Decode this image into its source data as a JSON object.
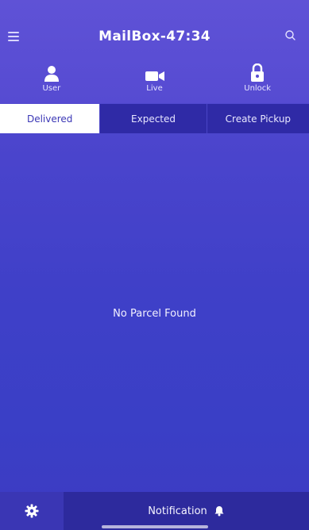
{
  "header": {
    "title": "MailBox-47:34",
    "icons": {
      "menu": "menu-icon",
      "search": "search-icon"
    },
    "actions": [
      {
        "label": "User",
        "icon": "user-icon"
      },
      {
        "label": "Live",
        "icon": "video-camera-icon"
      },
      {
        "label": "Unlock",
        "icon": "lock-icon"
      }
    ]
  },
  "tabs": [
    {
      "label": "Delivered",
      "active": true
    },
    {
      "label": "Expected",
      "active": false
    },
    {
      "label": "Create Pickup",
      "active": false
    }
  ],
  "content": {
    "empty_message": "No Parcel Found"
  },
  "bottom_bar": {
    "settings_icon": "gear-icon",
    "notification_label": "Notification",
    "notification_icon": "bell-icon"
  },
  "colors": {
    "header_bg": "#5f52d6",
    "tab_bar_bg": "#2f2aa6",
    "active_tab_bg": "#ffffff",
    "active_tab_text": "#3a36b5",
    "content_bg": "#3f40c8",
    "bottom_bar_bg": "#2d2a9d"
  }
}
